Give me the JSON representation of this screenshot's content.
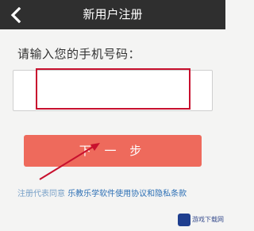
{
  "header": {
    "title": "新用户注册",
    "back_icon": "chevron-left-icon"
  },
  "form": {
    "prompt": "请输入您的手机号码：",
    "phone_value": "",
    "phone_placeholder": ""
  },
  "actions": {
    "next_label": "下 一 步"
  },
  "agreement": {
    "prefix": "注册代表同意",
    "link": "乐教乐学软件使用协议和隐私条款"
  },
  "watermark": {
    "text": "游戏下载网"
  },
  "colors": {
    "header_bg": "#2f2f2f",
    "button_bg": "#ee6a5c",
    "annotation_red": "#c8102e",
    "link_blue": "#2c6fb5"
  }
}
